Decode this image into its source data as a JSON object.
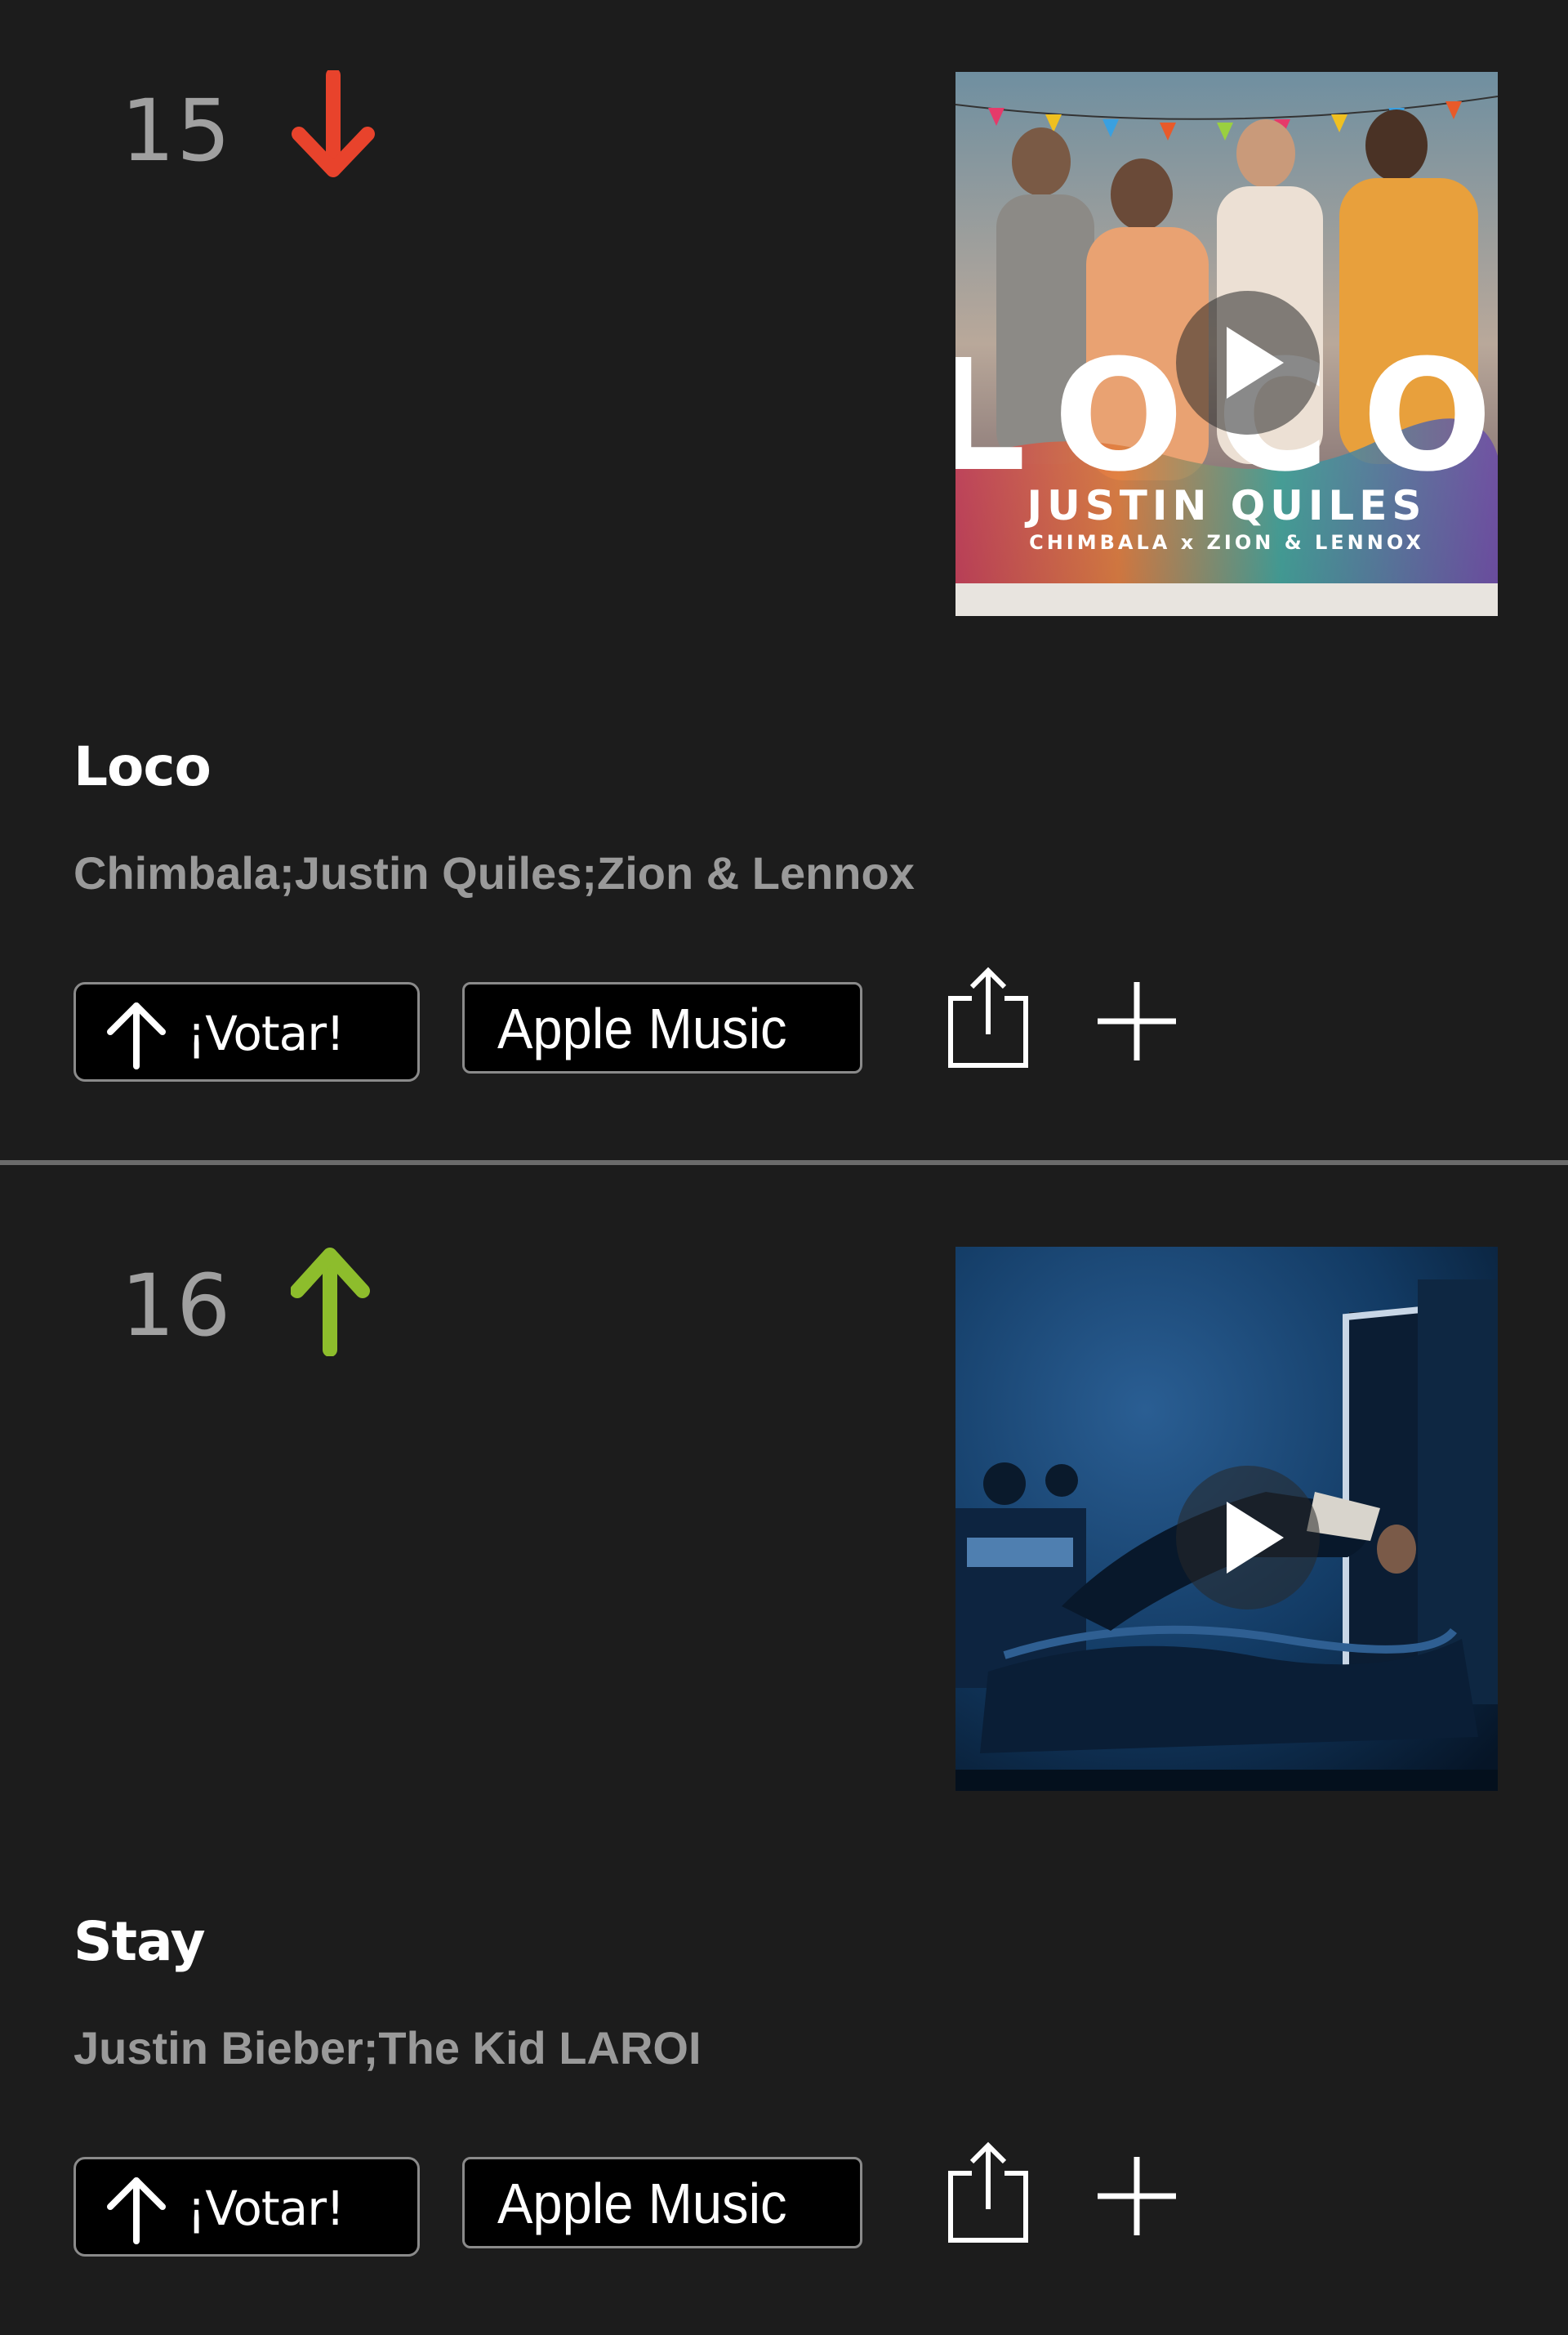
{
  "entries": [
    {
      "rank": "15",
      "trend": "down",
      "trend_color": "#e8432c",
      "title": "Loco",
      "artists": "Chimbala;Justin Quiles;Zion & Lennox",
      "cover": {
        "title_text": "LOCO",
        "artist_text": "JUSTIN QUILES",
        "featuring_text": "CHIMBALA x ZION & LENNOX"
      },
      "vote_label": "¡Votar!",
      "apple_label": "Apple Music"
    },
    {
      "rank": "16",
      "trend": "up",
      "trend_color": "#8dbd2c",
      "title": "Stay",
      "artists": "Justin Bieber;The Kid LAROI",
      "vote_label": "¡Votar!",
      "apple_label": "Apple Music"
    }
  ],
  "icons": {
    "vote": "arrow-up-icon",
    "share": "share-icon",
    "add": "plus-icon",
    "play": "play-icon",
    "trend_down": "arrow-down-icon",
    "trend_up": "arrow-up-icon"
  }
}
